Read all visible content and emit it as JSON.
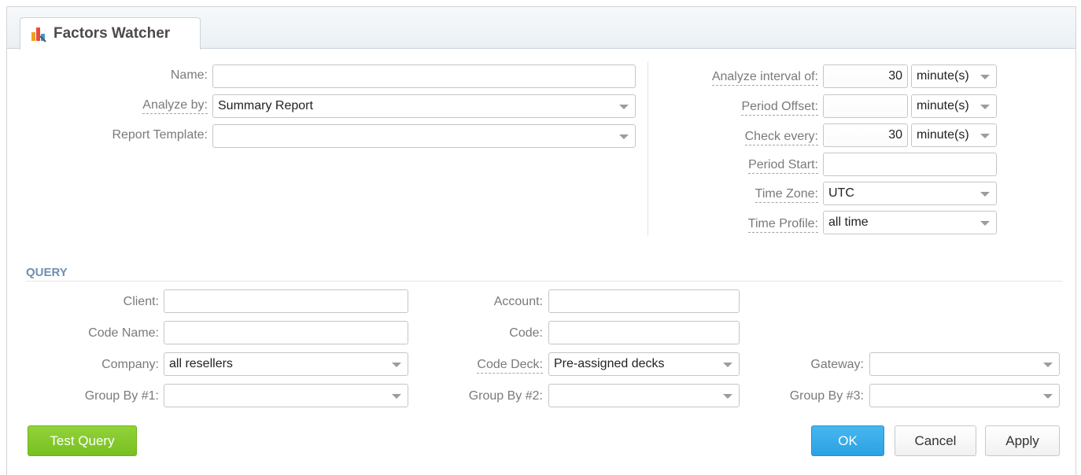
{
  "window": {
    "title": "Factors Watcher"
  },
  "main": {
    "name": {
      "label": "Name:",
      "value": ""
    },
    "analyze_by": {
      "label": "Analyze by:",
      "value": "Summary Report"
    },
    "report_template": {
      "label": "Report Template:",
      "value": ""
    }
  },
  "schedule": {
    "analyze_interval": {
      "label": "Analyze interval of:",
      "value": "30",
      "unit": "minute(s)"
    },
    "period_offset": {
      "label": "Period Offset:",
      "value": "",
      "unit": "minute(s)"
    },
    "check_every": {
      "label": "Check every:",
      "value": "30",
      "unit": "minute(s)"
    },
    "period_start": {
      "label": "Period Start:",
      "value": ""
    },
    "time_zone": {
      "label": "Time Zone:",
      "value": "UTC"
    },
    "time_profile": {
      "label": "Time Profile:",
      "value": "all time"
    }
  },
  "query": {
    "title": "QUERY",
    "client": {
      "label": "Client:",
      "value": ""
    },
    "account": {
      "label": "Account:",
      "value": ""
    },
    "code_name": {
      "label": "Code Name:",
      "value": ""
    },
    "code": {
      "label": "Code:",
      "value": ""
    },
    "company": {
      "label": "Company:",
      "value": "all resellers"
    },
    "code_deck": {
      "label": "Code Deck:",
      "value": "Pre-assigned decks"
    },
    "gateway": {
      "label": "Gateway:",
      "value": ""
    },
    "group_by_1": {
      "label": "Group By #1:",
      "value": ""
    },
    "group_by_2": {
      "label": "Group By #2:",
      "value": ""
    },
    "group_by_3": {
      "label": "Group By #3:",
      "value": ""
    }
  },
  "buttons": {
    "test_query": "Test Query",
    "ok": "OK",
    "cancel": "Cancel",
    "apply": "Apply"
  },
  "colors": {
    "accent_blue": "#2aa2e4",
    "accent_green": "#78c020",
    "section_title": "#6e8fb0"
  },
  "icons": {
    "tab_icon": "chart-icon",
    "dropdown": "chevron-down-icon"
  }
}
